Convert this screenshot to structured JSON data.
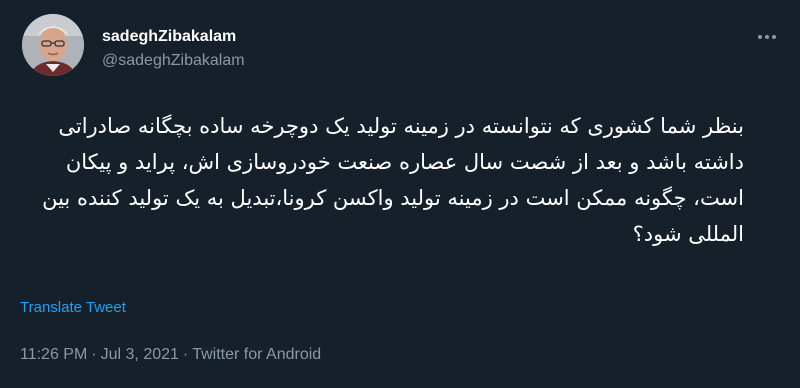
{
  "author": {
    "display_name": "sadeghZibakalam",
    "handle": "@sadeghZibakalam"
  },
  "tweet": {
    "text": "بنظر شما کشوری که نتوانسته در زمینه تولید یک دوچرخه ساده بچگانه صادراتی داشته باشد و بعد از شصت سال عصاره صنعت خودروسازی اش، پراید و پیکان است، چگونه ممکن است در زمینه تولید واکسن کرونا،تبدیل به یک تولید کننده بین المللی شود؟",
    "translate_label": "Translate Tweet",
    "time": "11:26 PM",
    "date": "Jul 3, 2021",
    "separator": "·",
    "source": "Twitter for Android"
  },
  "icons": {
    "more": "more-options-icon",
    "avatar": "profile-photo"
  },
  "colors": {
    "background": "#15202b",
    "primary_text": "#ffffff",
    "secondary_text": "#8899a6",
    "link": "#1da1f2"
  }
}
